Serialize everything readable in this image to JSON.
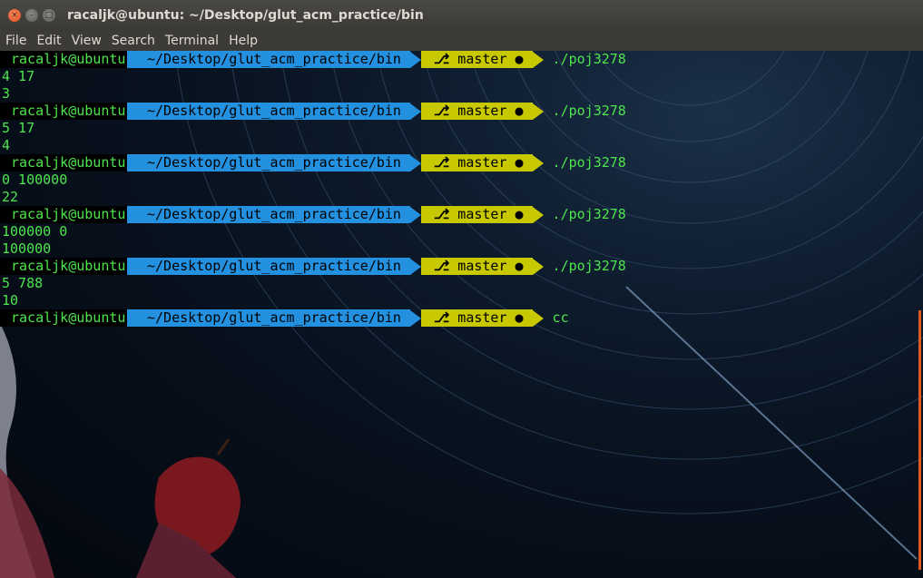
{
  "window": {
    "title": "racaljk@ubuntu: ~/Desktop/glut_acm_practice/bin",
    "close_glyph": "×",
    "min_glyph": "–",
    "max_glyph": "□"
  },
  "menu": [
    "File",
    "Edit",
    "View",
    "Search",
    "Terminal",
    "Help"
  ],
  "colors": {
    "prompt_user_fg": "#4ee44e",
    "path_bg": "#2490e0",
    "git_bg": "#c8c800",
    "output_fg": "#4ee44e"
  },
  "icons": {
    "branch": "git-branch-icon",
    "dirty": "dirty-dot-icon"
  },
  "terminal": {
    "lines": [
      {
        "kind": "prompt",
        "user": "racaljk@ubuntu",
        "path": "~/Desktop/glut_acm_practice/bin",
        "branch_glyph": "⎇",
        "branch": "master",
        "dot": "●",
        "cmd": "./poj3278"
      },
      {
        "kind": "out",
        "text": "4 17"
      },
      {
        "kind": "out",
        "text": "3"
      },
      {
        "kind": "prompt",
        "user": "racaljk@ubuntu",
        "path": "~/Desktop/glut_acm_practice/bin",
        "branch_glyph": "⎇",
        "branch": "master",
        "dot": "●",
        "cmd": "./poj3278"
      },
      {
        "kind": "out",
        "text": "5 17"
      },
      {
        "kind": "out",
        "text": "4"
      },
      {
        "kind": "prompt",
        "user": "racaljk@ubuntu",
        "path": "~/Desktop/glut_acm_practice/bin",
        "branch_glyph": "⎇",
        "branch": "master",
        "dot": "●",
        "cmd": "./poj3278"
      },
      {
        "kind": "out",
        "text": "0 100000"
      },
      {
        "kind": "out",
        "text": "22"
      },
      {
        "kind": "prompt",
        "user": "racaljk@ubuntu",
        "path": "~/Desktop/glut_acm_practice/bin",
        "branch_glyph": "⎇",
        "branch": "master",
        "dot": "●",
        "cmd": "./poj3278"
      },
      {
        "kind": "out",
        "text": "100000 0"
      },
      {
        "kind": "out",
        "text": "100000"
      },
      {
        "kind": "prompt",
        "user": "racaljk@ubuntu",
        "path": "~/Desktop/glut_acm_practice/bin",
        "branch_glyph": "⎇",
        "branch": "master",
        "dot": "●",
        "cmd": "./poj3278"
      },
      {
        "kind": "out",
        "text": "5 788"
      },
      {
        "kind": "out",
        "text": "10"
      },
      {
        "kind": "prompt",
        "user": "racaljk@ubuntu",
        "path": "~/Desktop/glut_acm_practice/bin",
        "branch_glyph": "⎇",
        "branch": "master",
        "dot": "●",
        "cmd": "cc"
      }
    ]
  }
}
